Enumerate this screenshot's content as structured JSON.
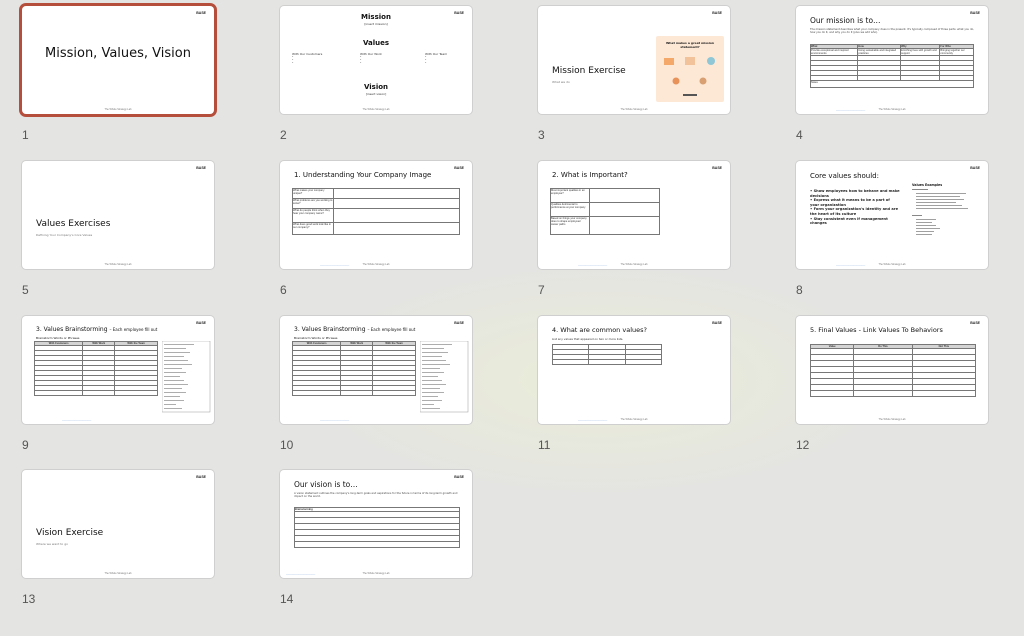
{
  "logo": "BASE",
  "footer": "The Whole Strategy Lab",
  "slides": [
    {
      "num": "1",
      "title": "Mission, Values, Vision"
    },
    {
      "num": "2",
      "mission": "Mission",
      "mission_sub": "[insert mission]",
      "values": "Values",
      "col1": "With Our Customers",
      "col2": "With Our Work",
      "col3": "With Our Team",
      "vision": "Vision",
      "vision_sub": "[insert vision]"
    },
    {
      "num": "3",
      "title": "Mission Exercise",
      "sub": "What we do",
      "card_title": "What makes a great mission statement?"
    },
    {
      "num": "4",
      "title": "Our mission is to…",
      "desc": "The mission statement describes what your company does in the present. It's typically composed of three parts: what you do, how you do it, and why you do it (plus we add who).",
      "headers": [
        "What",
        "How",
        "Why",
        "For Who"
      ],
      "row1": [
        "Provide exceptional and inspired environments",
        "Using sustainable and integrated practices",
        "Enriching lives with growth and support",
        "Bringing together our community"
      ],
      "notes": "Notes"
    },
    {
      "num": "5",
      "title": "Values Exercises",
      "sub": "Defining Your Company's Core Values"
    },
    {
      "num": "6",
      "title": "1.  Understanding Your Company Image",
      "rows": [
        "What makes your company unique?",
        "What problems are you working to solve?",
        "What do people think when they hear your company name?",
        "What does good work look like in our company?"
      ]
    },
    {
      "num": "7",
      "title": "2.  What is Important?",
      "rows": [
        "Most important qualities in an employee?",
        "Qualities detrimental to performance at your company",
        "Based on things your company does to shape employees' career paths"
      ]
    },
    {
      "num": "8",
      "title": "Core values should:",
      "bullets": [
        "Show employees how to behave and make decisions",
        "Express what it means to be a part of your organization",
        "Form your organization's identity and are the heart of its culture",
        "Stay consistent even if management changes"
      ],
      "side_title": "Values Examples"
    },
    {
      "num": "9",
      "title": "3. Values Brainstorming",
      "title_suffix": "– Each employee fill out",
      "sub": "Brainstorm Words or Phrases",
      "headers": [
        "With Customers",
        "With Work",
        "With the Team"
      ]
    },
    {
      "num": "10",
      "title": "3. Values Brainstorming",
      "title_suffix": "– Each employee fill out",
      "sub": "Brainstorm Words or Phrases",
      "headers": [
        "With Customers",
        "With Work",
        "With the Team"
      ]
    },
    {
      "num": "11",
      "title": "4.  What are common values?",
      "sub": "List any values that appeared on two or more lists."
    },
    {
      "num": "12",
      "title": "5.  Final Values - Link Values To Behaviors",
      "headers": [
        "Value",
        "Do This",
        "Not This"
      ]
    },
    {
      "num": "13",
      "title": "Vision Exercise",
      "sub": "Where we want to go"
    },
    {
      "num": "14",
      "title": "Our vision is to…",
      "desc": "A vision statement outlines the company's long-term goals and aspirations for the future in terms of its long-term growth and impact on the world.",
      "table_header": "Brainstorming"
    }
  ]
}
